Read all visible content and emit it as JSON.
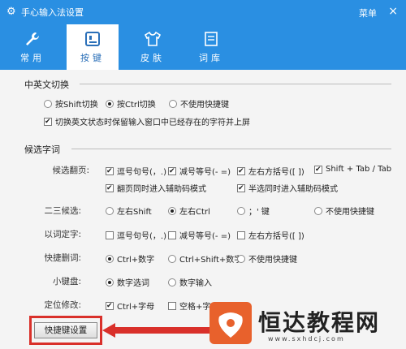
{
  "window": {
    "title": "手心输入法设置",
    "menu": "菜单",
    "close": "×"
  },
  "tabs": [
    {
      "label": "常用",
      "icon": "wrench-icon"
    },
    {
      "label": "按键",
      "icon": "keyboard-icon"
    },
    {
      "label": "皮肤",
      "icon": "shirt-icon"
    },
    {
      "label": "词库",
      "icon": "book-icon"
    }
  ],
  "sections": {
    "switch": {
      "title": "中英文切换",
      "radios": [
        "按Shift切换",
        "按Ctrl切换",
        "不使用快捷键"
      ],
      "selected": "按Ctrl切换",
      "keep_checkbox": "切换英文状态时保留输入窗口中已经存在的字符并上屏"
    },
    "candidate": {
      "title": "候选字词",
      "paging": {
        "label": "候选翻页:",
        "options": [
          "逗号句号(，.)",
          "减号等号(- =)",
          "左右方括号([ ])",
          "Shift + Tab / Tab",
          "翻页同时进入辅助码模式",
          "半选同时进入辅助码模式"
        ]
      },
      "second_third": {
        "label": "二三候选:",
        "options": [
          "左右Shift",
          "左右Ctrl",
          "；' 键",
          "不使用快捷键"
        ],
        "selected": "左右Ctrl"
      },
      "word_to_char": {
        "label": "以词定字:",
        "options": [
          "逗号句号(，.)",
          "减号等号(- =)",
          "左右方括号([ ])"
        ]
      },
      "delete_word": {
        "label": "快捷删词:",
        "options": [
          "Ctrl+数字",
          "Ctrl+Shift+数字",
          "不使用快捷键"
        ],
        "selected": "Ctrl+数字"
      },
      "keypad": {
        "label": "小键盘:",
        "options": [
          "数字选词",
          "数字输入"
        ],
        "selected": "数字选词"
      },
      "locate": {
        "label": "定位修改:",
        "options": [
          "Ctrl+字母",
          "空格+字"
        ]
      }
    }
  },
  "shortcut_button": "快捷键设置",
  "watermark": {
    "text": "恒达教程网",
    "url": "www.sxhdcj.com"
  },
  "colors": {
    "header": "#2a8fe2",
    "highlight": "#d9302a",
    "logo": "#e8612c"
  }
}
